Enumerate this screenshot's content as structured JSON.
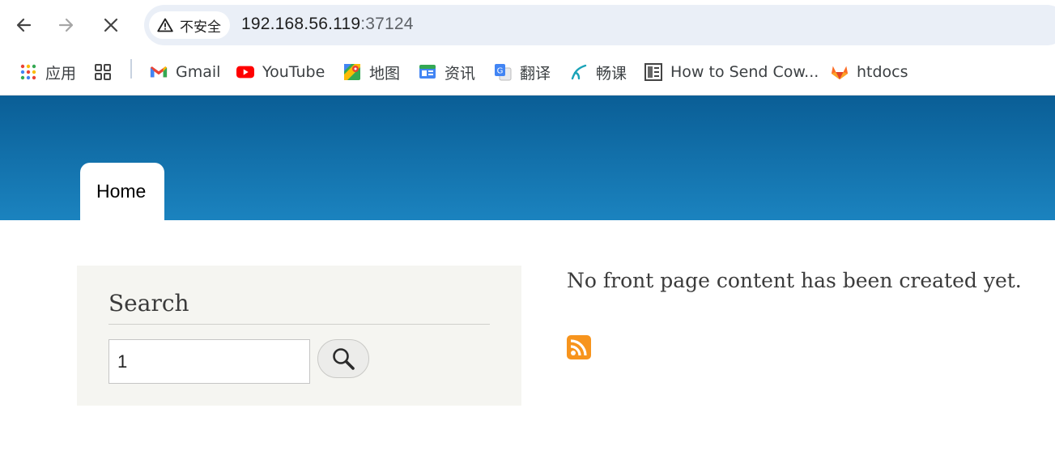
{
  "browser": {
    "security_label": "不安全",
    "url_host": "192.168.56.119",
    "url_port": ":37124"
  },
  "bookmarks": [
    {
      "label": "应用",
      "icon": "apps-grid-icon"
    },
    {
      "label": "",
      "icon": "tab-groups-icon"
    },
    {
      "label": "Gmail",
      "icon": "gmail-icon"
    },
    {
      "label": "YouTube",
      "icon": "youtube-icon"
    },
    {
      "label": "地图",
      "icon": "maps-icon"
    },
    {
      "label": "资讯",
      "icon": "news-icon"
    },
    {
      "label": "翻译",
      "icon": "translate-icon"
    },
    {
      "label": "畅课",
      "icon": "changke-icon"
    },
    {
      "label": "How to Send Cow...",
      "icon": "bookmark-page-icon"
    },
    {
      "label": "htdocs",
      "icon": "gitlab-icon"
    }
  ],
  "header": {
    "tab_home": "Home",
    "colors": {
      "top": "#0a5e96",
      "bottom": "#1b83bf"
    }
  },
  "sidebar": {
    "search_title": "Search",
    "search_value": "1",
    "search_button_icon": "magnifier-icon"
  },
  "main": {
    "message": "No front page content has been created yet.",
    "feed_icon": "rss-feed-icon",
    "feed_color": "#f7941d"
  }
}
